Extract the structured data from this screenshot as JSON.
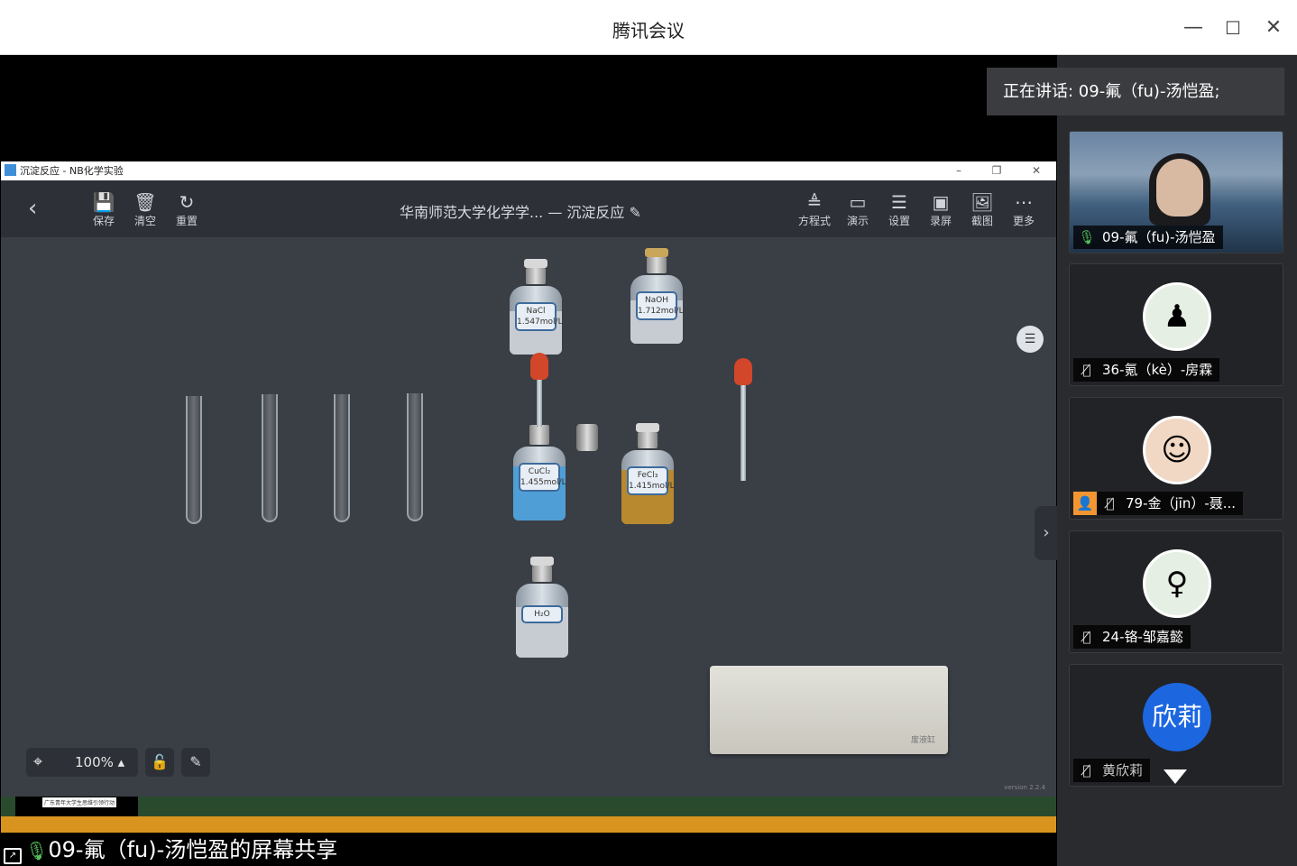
{
  "app": {
    "title": "腾讯会议",
    "minimize": "—",
    "maximize": "☐",
    "close": "✕"
  },
  "speaking_banner": "正在讲话: 09-氟（fu)-汤恺盈;",
  "shared_window": {
    "title": "沉淀反应 - NB化学实验",
    "toolbar": {
      "back": "‹",
      "left": [
        {
          "icon": "save-icon",
          "label": "保存"
        },
        {
          "icon": "trash-icon",
          "label": "清空"
        },
        {
          "icon": "reset-icon",
          "label": "重置"
        }
      ],
      "doc_title": "华南师范大学化学学... — 沉淀反应 ✎",
      "right": [
        {
          "icon": "equation-icon",
          "label": "方程式"
        },
        {
          "icon": "demo-icon",
          "label": "演示"
        },
        {
          "icon": "settings-icon",
          "label": "设置"
        },
        {
          "icon": "record-icon",
          "label": "录屏"
        },
        {
          "icon": "screenshot-icon",
          "label": "截图"
        },
        {
          "icon": "more-icon",
          "label": "更多"
        }
      ]
    },
    "bottles": [
      {
        "name": "NaCl",
        "conc": "1.547mol/L",
        "liquid": "#c7ccd2"
      },
      {
        "name": "NaOH",
        "conc": "1.712mol/L",
        "liquid": "#c7ccd2"
      },
      {
        "name": "CuCl₂",
        "conc": "1.455mol/L",
        "liquid": "#4f9fd6"
      },
      {
        "name": "FeCl₃",
        "conc": "1.415mol/L",
        "liquid": "#b8892e"
      },
      {
        "name": "H₂O",
        "conc": "",
        "liquid": "#c7ccd2"
      }
    ],
    "trough_label": "废液缸",
    "zoom": "100% ▴",
    "version": "version 2.2.4",
    "credit": "广东青年大学生思维引领行动"
  },
  "participants": [
    {
      "name": "09-氟（fu)-汤恺盈",
      "mic": "on",
      "type": "video"
    },
    {
      "name": "36-氪（kè）-房霖",
      "mic": "muted",
      "type": "avatar",
      "avatar": "♟"
    },
    {
      "name": "79-金（jīn）-聂...",
      "mic": "muted",
      "type": "avatar",
      "avatar": "☺",
      "badge": "👤"
    },
    {
      "name": "24-铬-邹嘉懿",
      "mic": "muted",
      "type": "avatar",
      "avatar": "♀"
    },
    {
      "name": "黄欣莉",
      "mic": "muted",
      "type": "text-avatar",
      "avatar": "欣莉"
    }
  ],
  "share_caption": "09-氟（fu)-汤恺盈的屏幕共享",
  "colors": {
    "accent": "#1c67e0",
    "toolbar": "#2d3037",
    "canvas": "#3a3e45"
  }
}
